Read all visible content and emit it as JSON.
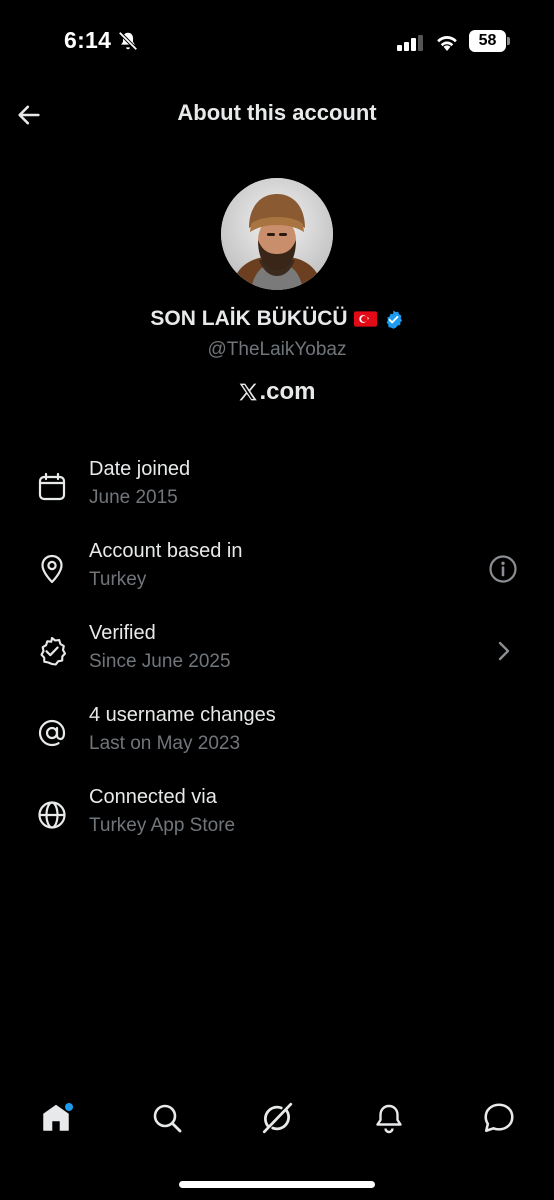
{
  "status_bar": {
    "time": "6:14",
    "battery": "58"
  },
  "header": {
    "title": "About this account"
  },
  "profile": {
    "name": "SON LAİK BÜKÜCÜ",
    "handle": "@TheLaikYobaz",
    "site": ".com",
    "verified_color": "#1d9bf0"
  },
  "details": [
    {
      "icon": "calendar-icon",
      "title": "Date joined",
      "subtitle": "June 2015"
    },
    {
      "icon": "location-pin-icon",
      "title": "Account based in",
      "subtitle": "Turkey",
      "action_icon": "info-icon"
    },
    {
      "icon": "verified-outline-icon",
      "title": "Verified",
      "subtitle": "Since June 2025",
      "action_icon": "chevron-right-icon"
    },
    {
      "icon": "at-sign-icon",
      "title": "4 username changes",
      "subtitle": "Last on May 2023"
    },
    {
      "icon": "globe-icon",
      "title": "Connected via",
      "subtitle": "Turkey App Store"
    }
  ],
  "bottom_nav": [
    {
      "icon": "home-icon",
      "badge": true
    },
    {
      "icon": "search-icon"
    },
    {
      "icon": "grok-icon"
    },
    {
      "icon": "bell-icon"
    },
    {
      "icon": "messages-icon"
    }
  ],
  "colors": {
    "background": "#000000",
    "text_primary": "#e7e9ea",
    "text_secondary": "#71767b",
    "accent": "#1d9bf0"
  }
}
